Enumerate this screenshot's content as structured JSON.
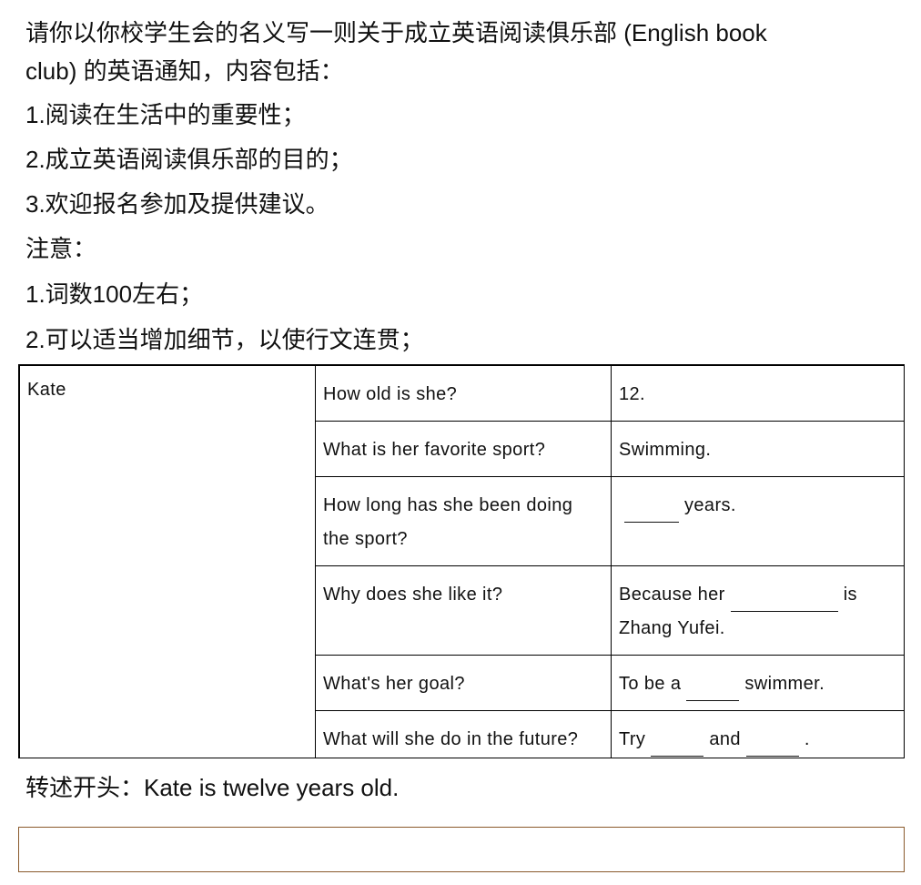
{
  "prompt": {
    "line1": "请你以你校学生会的名义写一则关于成立英语阅读俱乐部 (English book",
    "line2": "club) 的英语通知，内容包括：",
    "items": [
      "1.阅读在生活中的重要性；",
      "2.成立英语阅读俱乐部的目的；",
      "3.欢迎报名参加及提供建议。"
    ],
    "note_label": "注意：",
    "notes": [
      "1.词数100左右；",
      "2.可以适当增加细节，以使行文连贯；"
    ]
  },
  "table": {
    "name": "Kate",
    "rows": [
      {
        "question": "How old is she?",
        "answer": "12."
      },
      {
        "question": "What is her favorite sport?",
        "answer": "Swimming."
      },
      {
        "question": "How long has she been doing the sport?",
        "answer_suffix": "years."
      },
      {
        "question": "Why does she like it?",
        "answer_prefix": "Because her",
        "answer_suffix": "is Zhang Yufei."
      },
      {
        "question": "What's her goal?",
        "answer_prefix": "To be a",
        "answer_suffix": "swimmer."
      },
      {
        "question": "What will she do in the future?",
        "answer_prefix": "Try",
        "answer_middle": "and",
        "answer_suffix": "."
      }
    ]
  },
  "start": {
    "text": "转述开头：Kate is twelve years old."
  },
  "answer_box": {
    "value": ""
  }
}
